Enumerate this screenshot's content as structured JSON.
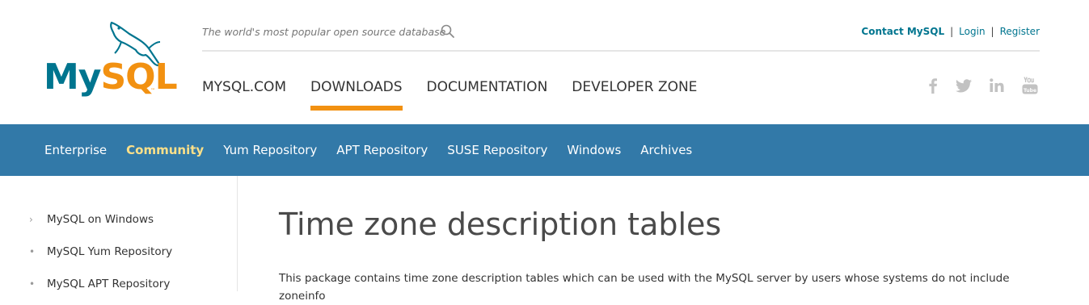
{
  "header": {
    "logo": {
      "text_my": "My",
      "text_sql": "SQL",
      "tm": "™"
    },
    "tagline": "The world's most popular open source database",
    "search_icon": "search-icon",
    "util_links": {
      "contact": "Contact MySQL",
      "separator": "|",
      "login": "Login",
      "register": "Register"
    },
    "main_nav": [
      {
        "label": "MYSQL.COM",
        "active": false
      },
      {
        "label": "DOWNLOADS",
        "active": true
      },
      {
        "label": "DOCUMENTATION",
        "active": false
      },
      {
        "label": "DEVELOPER ZONE",
        "active": false
      }
    ],
    "social": [
      "facebook-icon",
      "twitter-icon",
      "linkedin-icon",
      "youtube-icon"
    ]
  },
  "subnav": {
    "items": [
      {
        "label": "Enterprise",
        "active": false
      },
      {
        "label": "Community",
        "active": true
      },
      {
        "label": "Yum Repository",
        "active": false
      },
      {
        "label": "APT Repository",
        "active": false
      },
      {
        "label": "SUSE Repository",
        "active": false
      },
      {
        "label": "Windows",
        "active": false
      },
      {
        "label": "Archives",
        "active": false
      }
    ]
  },
  "sidebar": {
    "items": [
      {
        "label": "MySQL on Windows",
        "marker": "›"
      },
      {
        "label": "MySQL Yum Repository",
        "marker": "•"
      },
      {
        "label": "MySQL APT Repository",
        "marker": "•"
      }
    ]
  },
  "content": {
    "title": "Time zone description tables",
    "description": "This package contains time zone description tables which can be used with the MySQL server by users whose systems do not include zoneinfo"
  },
  "colors": {
    "brand_blue": "#00758f",
    "brand_orange": "#f29111",
    "subnav_bg": "#3279a8",
    "subnav_active": "#fde089"
  }
}
